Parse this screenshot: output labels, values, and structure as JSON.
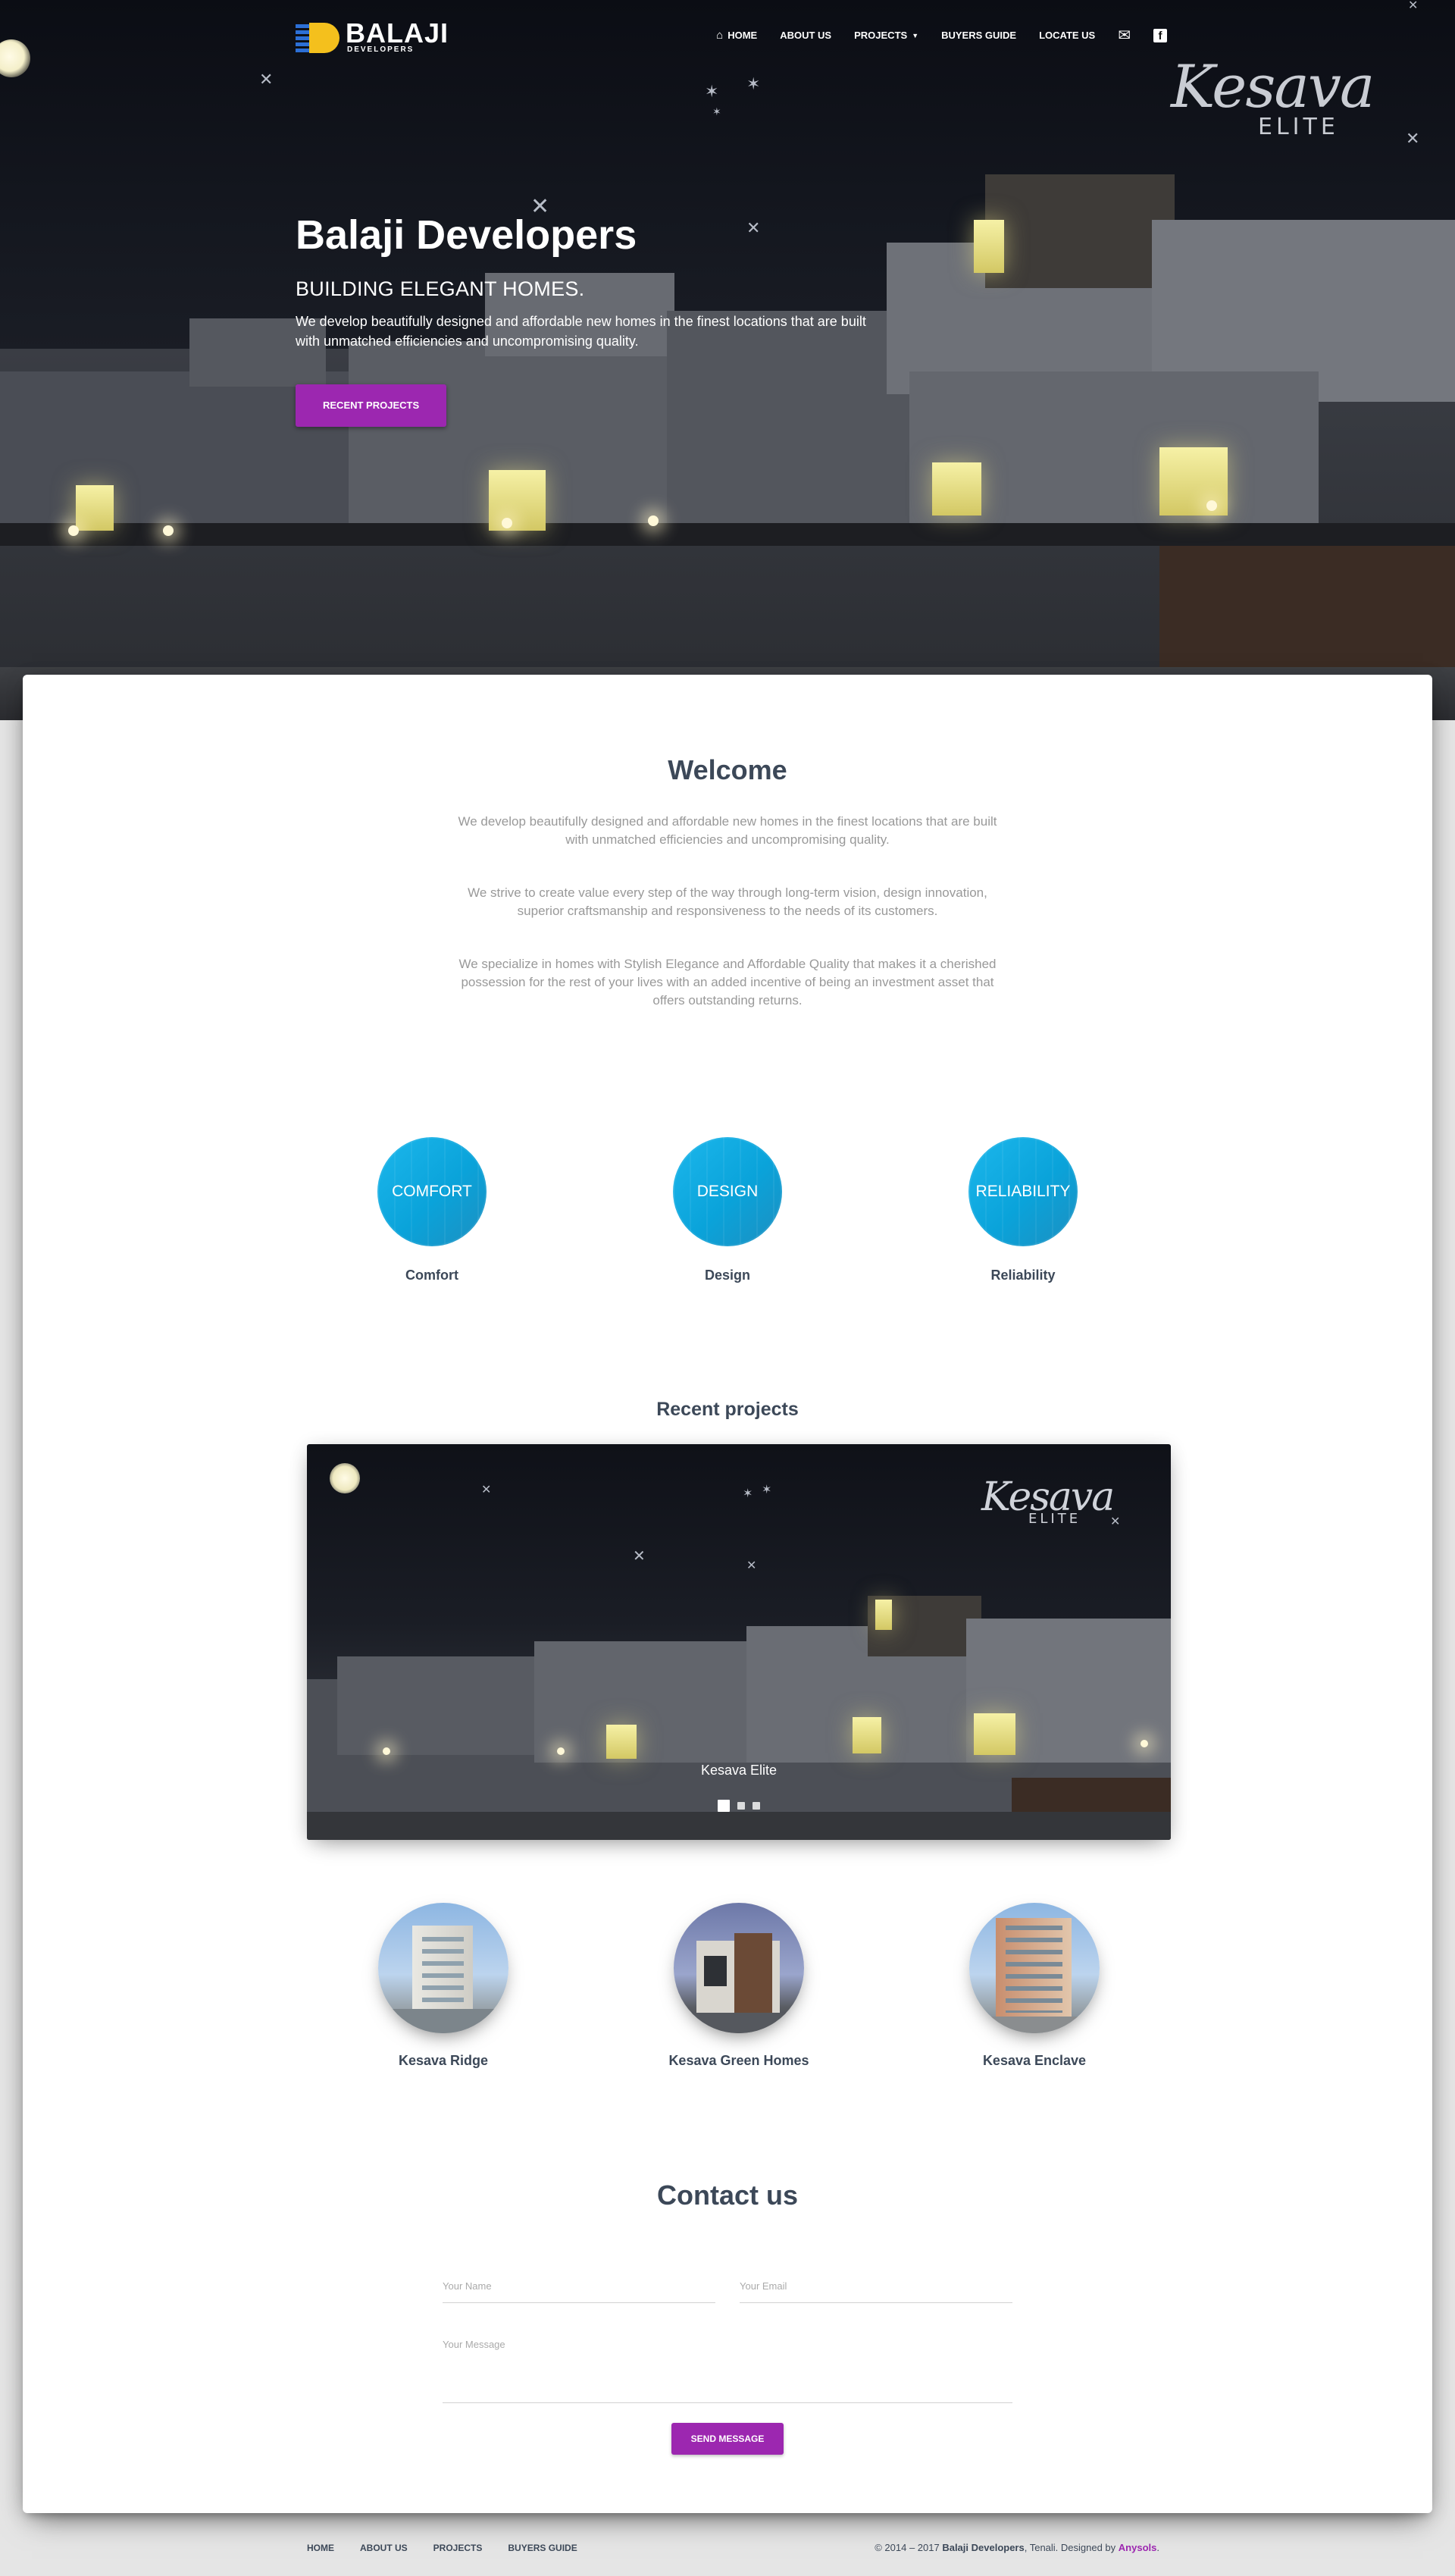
{
  "brand": {
    "name": "BALAJI",
    "tagline": "DEVELOPERS"
  },
  "nav": {
    "items": [
      {
        "label": "HOME",
        "icon": "home-icon"
      },
      {
        "label": "ABOUT US"
      },
      {
        "label": "PROJECTS",
        "icon": "caret-down-icon"
      },
      {
        "label": "BUYERS GUIDE"
      },
      {
        "label": "LOCATE US"
      }
    ],
    "icons": [
      "envelope-icon",
      "facebook-icon"
    ]
  },
  "hero": {
    "logo_script": "Kesava",
    "logo_sub": "ELITE",
    "title": "Balaji Developers",
    "subtitle": "BUILDING ELEGANT HOMES.",
    "description": "We develop beautifully designed and affordable new homes in the finest locations that are built with unmatched efficiencies and uncompromising quality.",
    "cta": "RECENT PROJECTS"
  },
  "welcome": {
    "title": "Welcome",
    "paragraphs": [
      "We develop beautifully designed and affordable new homes in the finest locations that are built with unmatched efficiencies and uncompromising quality.",
      "We strive to create value every step of the way through long-term vision, design innovation, superior craftsmanship and responsiveness to the needs of its customers.",
      "We specialize in homes with Stylish Elegance and Affordable Quality that makes it a cherished possession for the rest of your lives with an added incentive of being an investment asset that offers outstanding returns."
    ]
  },
  "features": [
    {
      "badge": "COMFORT",
      "label": "Comfort"
    },
    {
      "badge": "DESIGN",
      "label": "Design"
    },
    {
      "badge": "RELIABILITY",
      "label": "Reliability"
    }
  ],
  "recent": {
    "title": "Recent projects",
    "slide_caption": "Kesava Elite",
    "slide_logo_script": "Kesava",
    "slide_logo_sub": "ELITE",
    "slides_count": 3,
    "active_slide": 1,
    "projects": [
      {
        "name": "Kesava Ridge"
      },
      {
        "name": "Kesava Green Homes"
      },
      {
        "name": "Kesava Enclave"
      }
    ]
  },
  "contact": {
    "title": "Contact us",
    "name_placeholder": "Your Name",
    "email_placeholder": "Your Email",
    "message_placeholder": "Your Message",
    "submit": "SEND MESSAGE"
  },
  "footer": {
    "links": [
      "HOME",
      "ABOUT US",
      "PROJECTS",
      "BUYERS GUIDE"
    ],
    "copyright_prefix": "© 2014 – 2017",
    "company": "Balaji Developers",
    "location": ", Tenali. Designed by",
    "designer": "Anysols",
    "suffix": "."
  },
  "colors": {
    "accent": "#9c27b0",
    "feature_circle": "#0aa3da",
    "text_dark": "#3c4858",
    "text_muted": "#999999"
  }
}
